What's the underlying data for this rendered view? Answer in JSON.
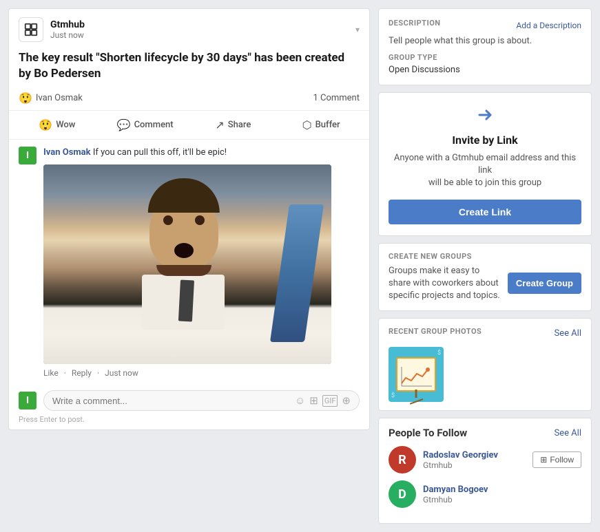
{
  "post": {
    "app_name": "Gtmhub",
    "post_time": "Just now",
    "title": "The key result \"Shorten lifecycle by 30 days\" has been created by Bo Pedersen",
    "author": "Ivan Osmak",
    "comment_count": "1 Comment",
    "actions": [
      {
        "id": "wow",
        "label": "Wow",
        "icon": "😲"
      },
      {
        "id": "comment",
        "label": "Comment",
        "icon": "💬"
      },
      {
        "id": "share",
        "label": "Share",
        "icon": "↗"
      },
      {
        "id": "buffer",
        "label": "Buffer",
        "icon": "⬡"
      }
    ],
    "comment": {
      "author": "Ivan Osmak",
      "text": "If you can pull this off, it'll be epic!",
      "time": "Just now",
      "like": "Like",
      "reply": "Reply"
    },
    "comment_input_placeholder": "Write a comment...",
    "press_enter_hint": "Press Enter to post."
  },
  "right": {
    "description_label": "DESCRIPTION",
    "add_description_label": "Add a Description",
    "description_text": "Tell people what this group is about.",
    "group_type_label": "GROUP TYPE",
    "group_type_value": "Open Discussions",
    "invite_section": {
      "icon": "→",
      "title": "Invite by Link",
      "description_part1": "Anyone with a Gtmhub email address and this link",
      "description_part2": "will be able to join this group",
      "button_label": "Create Link"
    },
    "create_groups_section": {
      "label": "CREATE NEW GROUPS",
      "description": "Groups make it easy to share with coworkers about specific projects and topics.",
      "button_label": "Create Group"
    },
    "recent_photos_section": {
      "label": "RECENT GROUP PHOTOS",
      "see_all": "See All"
    },
    "people_section": {
      "label": "People To Follow",
      "see_all": "See All",
      "people": [
        {
          "name": "Radoslav Georgiev",
          "company": "Gtmhub",
          "avatar_letter": "R",
          "avatar_color": "avatar-red"
        },
        {
          "name": "Damyan Bogoev",
          "company": "Gtmhub",
          "avatar_letter": "D",
          "avatar_color": "avatar-green"
        }
      ],
      "follow_label": "Follow"
    }
  }
}
